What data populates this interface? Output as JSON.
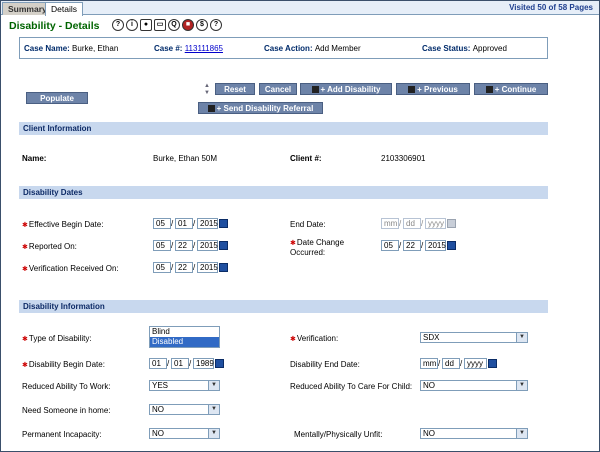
{
  "tabs": [
    {
      "label": "Summary"
    },
    {
      "label": "Details"
    }
  ],
  "visited": "Visited 50 of 58 Pages",
  "title": "Disability - Details",
  "icons": [
    {
      "name": "help-icon",
      "glyph": "?"
    },
    {
      "name": "info-icon",
      "glyph": "i"
    },
    {
      "name": "person-icon",
      "glyph": "●"
    },
    {
      "name": "page-icon",
      "glyph": "▭"
    },
    {
      "name": "search-icon",
      "glyph": "Q"
    },
    {
      "name": "stop-icon",
      "glyph": "■"
    },
    {
      "name": "dollar-icon",
      "glyph": "$"
    },
    {
      "name": "query-icon",
      "glyph": "?"
    }
  ],
  "case": {
    "name_label": "Case Name:",
    "name_value": "Burke, Ethan",
    "number_label": "Case #:",
    "number_value": "113111865",
    "action_label": "Case Action:",
    "action_value": "Add Member",
    "status_label": "Case Status:",
    "status_value": "Approved"
  },
  "buttons": {
    "populate": "Populate",
    "reset": "Reset",
    "cancel": "Cancel",
    "add_disability": "+ Add Disability",
    "previous": "+ Previous",
    "continue": "+ Continue",
    "send_referral": "+ Send Disability Referral"
  },
  "sections": {
    "client": "Client Information",
    "dates": "Disability Dates",
    "info": "Disability Information"
  },
  "client": {
    "name_label": "Name:",
    "name_value": "Burke, Ethan 50M",
    "number_label": "Client #:",
    "number_value": "2103306901"
  },
  "dates": {
    "effective_begin_label": "Effective Begin Date:",
    "effective_begin": {
      "mm": "05",
      "dd": "01",
      "yyyy": "2015"
    },
    "end_label": "End Date:",
    "end": {
      "mm": "mm",
      "dd": "dd",
      "yyyy": "yyyy"
    },
    "reported_label": "Reported On:",
    "reported": {
      "mm": "05",
      "dd": "22",
      "yyyy": "2015"
    },
    "change_label_1": "Date Change",
    "change_label_2": "Occurred:",
    "change": {
      "mm": "05",
      "dd": "22",
      "yyyy": "2015"
    },
    "verification_label": "Verification Received On:",
    "verification": {
      "mm": "05",
      "dd": "22",
      "yyyy": "2015"
    }
  },
  "info": {
    "type_label": "Type of Disability:",
    "type_options": [
      "Blind",
      "Disabled"
    ],
    "verification_label": "Verification:",
    "verification_value": "SDX",
    "begin_label": "Disability Begin Date:",
    "begin": {
      "mm": "01",
      "dd": "01",
      "yyyy": "1989"
    },
    "end_label": "Disability End Date:",
    "end": {
      "mm": "mm",
      "dd": "dd",
      "yyyy": "yyyy"
    },
    "reduced_work_label": "Reduced Ability To Work:",
    "reduced_work_value": "YES",
    "reduced_care_label": "Reduced Ability To Care For Child:",
    "reduced_care_value": "NO",
    "need_someone_label": "Need Someone in home:",
    "need_someone_value": "NO",
    "permanent_label": "Permanent Incapacity:",
    "permanent_value": "NO",
    "unfit_label": "Mentally/Physically Unfit:",
    "unfit_value": "NO"
  },
  "colors": {
    "title": "#006400",
    "section_bg": "#c8d8ee",
    "button_bg": "#6d83a8"
  }
}
